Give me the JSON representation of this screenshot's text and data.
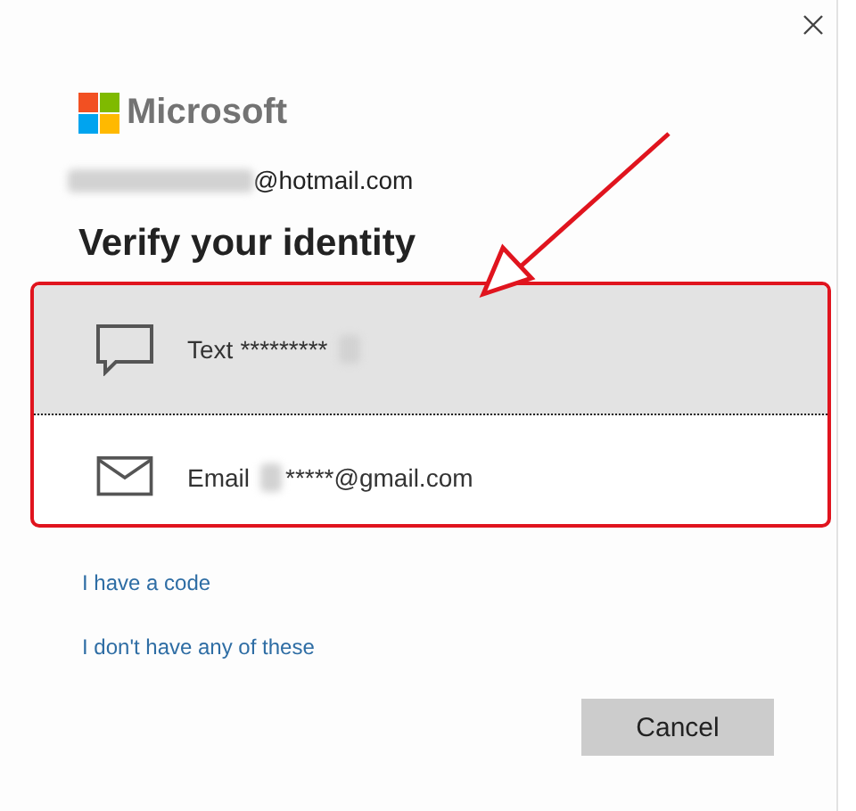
{
  "brand": {
    "name": "Microsoft"
  },
  "account": {
    "email_suffix": "@hotmail.com"
  },
  "heading": "Verify your identity",
  "options": [
    {
      "kind": "sms",
      "label": "Text",
      "value_after": "*********",
      "selected": true
    },
    {
      "kind": "email",
      "label": "Email",
      "value_after": "*****@gmail.com",
      "selected": false
    }
  ],
  "links": [
    "I have a code",
    "I don't have any of these"
  ],
  "buttons": [
    "Cancel"
  ]
}
